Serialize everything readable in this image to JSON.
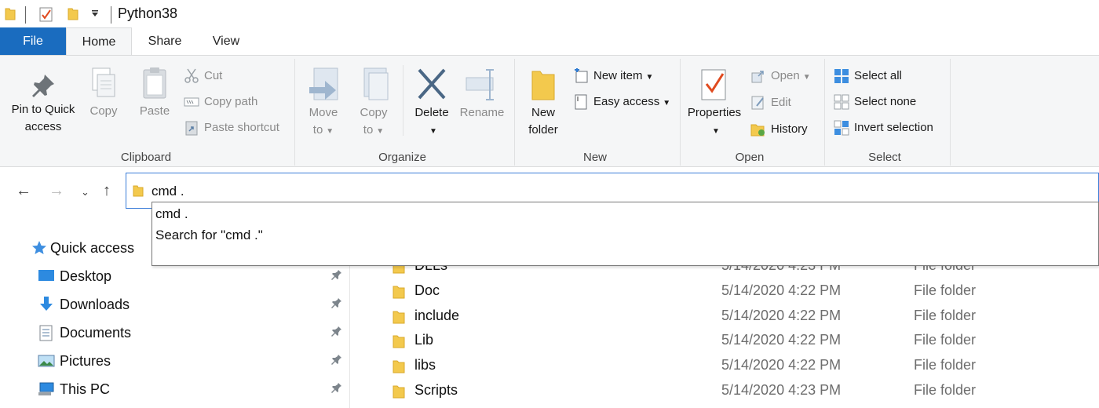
{
  "window": {
    "title": "Python38"
  },
  "tabs": {
    "file": "File",
    "home": "Home",
    "share": "Share",
    "view": "View"
  },
  "ribbon": {
    "clipboard": {
      "label": "Clipboard",
      "pin_line1": "Pin to Quick",
      "pin_line2": "access",
      "copy": "Copy",
      "paste": "Paste",
      "cut": "Cut",
      "copy_path": "Copy path",
      "paste_shortcut": "Paste shortcut"
    },
    "organize": {
      "label": "Organize",
      "move_line1": "Move",
      "move_line2": "to",
      "copy_line1": "Copy",
      "copy_line2": "to",
      "delete": "Delete",
      "rename": "Rename"
    },
    "new": {
      "label": "New",
      "new_folder_line1": "New",
      "new_folder_line2": "folder",
      "new_item": "New item",
      "easy_access": "Easy access"
    },
    "open": {
      "label": "Open",
      "properties": "Properties",
      "open": "Open",
      "edit": "Edit",
      "history": "History"
    },
    "select": {
      "label": "Select",
      "select_all": "Select all",
      "select_none": "Select none",
      "invert_selection": "Invert selection"
    }
  },
  "address": {
    "value": "cmd ."
  },
  "autocomplete": [
    {
      "label": "cmd ."
    },
    {
      "label": "Search for \"cmd .\""
    }
  ],
  "nav_pane": [
    {
      "label": "Quick access",
      "icon": "star-icon"
    },
    {
      "label": "Desktop",
      "icon": "desktop-icon",
      "pinned": true
    },
    {
      "label": "Downloads",
      "icon": "download-icon",
      "pinned": true
    },
    {
      "label": "Documents",
      "icon": "document-icon",
      "pinned": true
    },
    {
      "label": "Pictures",
      "icon": "pictures-icon",
      "pinned": true
    },
    {
      "label": "This PC",
      "icon": "computer-icon",
      "pinned": true
    }
  ],
  "files": [
    {
      "name": "DLLs",
      "date": "5/14/2020 4:23 PM",
      "type": "File folder"
    },
    {
      "name": "Doc",
      "date": "5/14/2020 4:22 PM",
      "type": "File folder"
    },
    {
      "name": "include",
      "date": "5/14/2020 4:22 PM",
      "type": "File folder"
    },
    {
      "name": "Lib",
      "date": "5/14/2020 4:22 PM",
      "type": "File folder"
    },
    {
      "name": "libs",
      "date": "5/14/2020 4:22 PM",
      "type": "File folder"
    },
    {
      "name": "Scripts",
      "date": "5/14/2020 4:23 PM",
      "type": "File folder"
    }
  ],
  "colors": {
    "accent": "#1a6cbf",
    "folder": "#f3c94d",
    "ribbon_bg": "#f5f6f7"
  }
}
